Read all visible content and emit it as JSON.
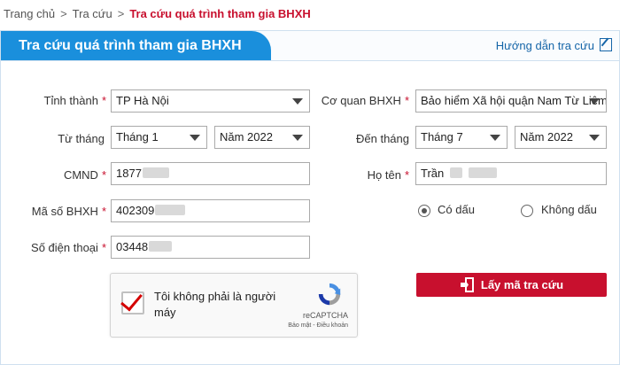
{
  "breadcrumb": {
    "home": "Trang chủ",
    "lookup": "Tra cứu",
    "current": "Tra cứu quá trình tham gia BHXH",
    "separator": ">"
  },
  "panel": {
    "title": "Tra cứu quá trình tham gia BHXH",
    "guide": "Hướng dẫn tra cứu"
  },
  "form": {
    "province_label": "Tỉnh thành",
    "province_value": "TP Hà Nội",
    "agency_label": "Cơ quan BHXH",
    "agency_value": "Bảo hiểm Xã hội quận Nam Từ Liêm",
    "from_label": "Từ tháng",
    "from_month": "Tháng 1",
    "from_year": "Năm 2022",
    "to_label": "Đến tháng",
    "to_month": "Tháng 7",
    "to_year": "Năm 2022",
    "id_label": "CMND",
    "id_value": "1877",
    "name_label": "Họ tên",
    "name_value": "Trần",
    "insurance_label": "Mã số BHXH",
    "insurance_value": "402309",
    "phone_label": "Số điện thoại",
    "phone_value": "03448",
    "accent_yes": "Có dấu",
    "accent_no": "Không dấu",
    "required_mark": "*"
  },
  "captcha": {
    "text": "Tôi không phải là người máy",
    "brand": "reCAPTCHA",
    "links": "Bảo mật - Điều khoản"
  },
  "submit": {
    "label": "Lấy mã tra cứu"
  },
  "colors": {
    "accent_blue": "#1a8fdc",
    "accent_red": "#c8102e"
  }
}
